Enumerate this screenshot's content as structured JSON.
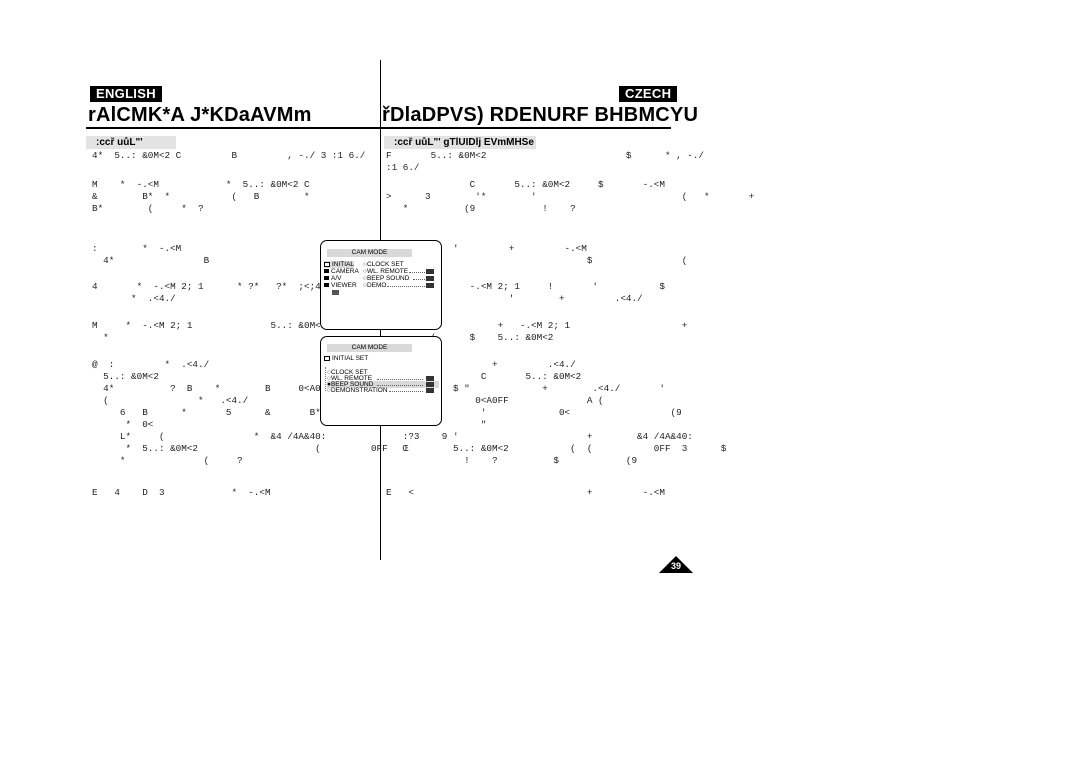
{
  "left": {
    "language": "ENGLISH",
    "title": "rAlCMK*A J*KDaAVMm",
    "section": ":ccř uůL\"'",
    "paragraphs": [
      [
        "4*  5..: &0M<2 C         B         , -./ 3 :1 6./"
      ],
      [
        "M    *  -.<M            *  5..: &0M<2 C",
        "&        B*  *           (   B        *",
        "B*        (     *  ?"
      ],
      [
        ":        *  -.<M",
        "  4*                B"
      ],
      [
        "4       *  -.<M 2; 1      * ?*   ?*  ;<;4;",
        "       *  .<4./"
      ],
      [
        "M     *  -.<M 2; 1              5..: &0M<2",
        "  *"
      ],
      [
        "@  :         *  .<4./",
        "  5..: &0M<2",
        "  4*          ?  B    *        B     0<A0FF",
        "  (                *   .<4./",
        "     6   B      *       5      &       B*    (",
        "      *  0<",
        "     L*     (                *  &4 /4A&40:",
        "      *  5..: &0M<2                     (         0FF",
        "     *              (     ?"
      ],
      [
        "E   4    D  3            *  -.<M"
      ]
    ]
  },
  "right": {
    "language": "CZECH",
    "title": "řDlaDPVS) RDENURF BHBMCYU",
    "section": ":ccř uůL\"' gTlUIDlj EVmMHSe",
    "paragraphs": [
      [
        "F       5..: &0M<2                         $      * , -./",
        ":1 6./"
      ],
      [
        "               C       5..: &0M<2     $       -.<M",
        ">      3        '*        '                          (   *       +",
        "   *          (9            !    ?"
      ],
      [
        "&           '         +         -.<M",
        "   >                                $                (",
        ""
      ],
      [
        "0        +     -.<M 2; 1     !       '           $",
        ";<;4; 1               '        +         .<4./"
      ],
      [
        ":                   +   -.<M 2; 1                    +",
        "        (      $    5..: &0M<2"
      ],
      [
        "@   &              +         .<4./",
        "                 C       5..: &0M<2",
        "   :        $ \"             +        .<4./       '",
        "                0<A0FF              A (",
        "     :           '             0<                  (9",
        "                 \"",
        "   :?3    9 '                       +        &4 /4A&40:",
        "   Œ        5..: &0M<2           (  (           0FF  3      $",
        "              !    ?          $            (9"
      ],
      [
        "E   <                               +         -.<M"
      ]
    ]
  },
  "osd1": {
    "header": "CAM  MODE",
    "menu": [
      {
        "label": "INITIAL",
        "icon": "folder-open-icon",
        "selected": true
      },
      {
        "label": "CAMERA",
        "icon": "folder-icon"
      },
      {
        "label": "A/V",
        "icon": "folder-icon"
      },
      {
        "label": "VIEWER",
        "icon": "folder-icon"
      }
    ],
    "submenu": [
      "CLOCK  SET",
      "WL. REMOTE",
      "BEEP SOUND",
      "DEMO"
    ]
  },
  "osd2": {
    "header": "CAM  MODE",
    "folder": "INITIAL SET",
    "items": [
      "CLOCK  SET",
      "WL. REMOTE",
      "BEEP SOUND",
      "DEMONSTRATION"
    ],
    "selected_index": 2
  },
  "page_number": "39"
}
